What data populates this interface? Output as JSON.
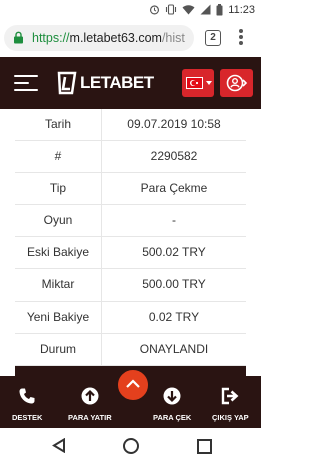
{
  "status_bar": {
    "time": "11:23"
  },
  "browser": {
    "url_scheme": "https://",
    "url_host": "m.letabet63.com",
    "url_path": "/hist",
    "tab_count": "2"
  },
  "header": {
    "logo_text": "LETABET"
  },
  "transaction": {
    "rows": [
      {
        "label": "Tarih",
        "value": "09.07.2019 10:58"
      },
      {
        "label": "#",
        "value": "2290582"
      },
      {
        "label": "Tip",
        "value": "Para Çekme"
      },
      {
        "label": "Oyun",
        "value": "-"
      },
      {
        "label": "Eski Bakiye",
        "value": "500.02 TRY"
      },
      {
        "label": "Miktar",
        "value": "500.00 TRY"
      },
      {
        "label": "Yeni Bakiye",
        "value": "0.02 TRY"
      },
      {
        "label": "Durum",
        "value": "ONAYLANDI"
      }
    ]
  },
  "bottom_nav": {
    "support": "DESTEK",
    "deposit": "PARA YATIR",
    "withdraw": "PARA ÇEK",
    "logout": "ÇIKIŞ YAP"
  },
  "colors": {
    "header_bg": "#2a1412",
    "accent_red": "#d8262b",
    "fab_orange": "#e4401d",
    "https_green": "#1e8e3e"
  },
  "icons": {
    "status": [
      "alarm-icon",
      "vibrate-icon",
      "wifi-icon",
      "signal-icon",
      "battery-icon"
    ],
    "nav": [
      "phone-icon",
      "arrow-up-circle-icon",
      "arrow-down-circle-icon",
      "exit-icon"
    ]
  }
}
